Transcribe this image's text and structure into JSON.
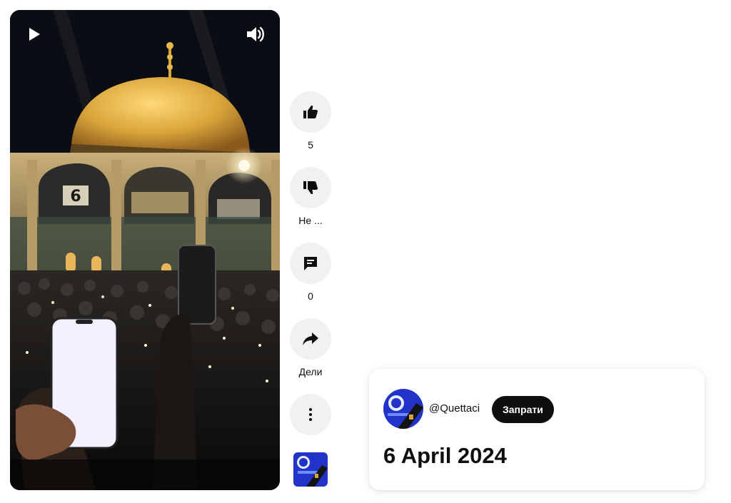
{
  "player": {
    "play_icon": "play-icon",
    "volume_icon": "volume-icon",
    "scene_gate_number": "6"
  },
  "actions": {
    "like": {
      "icon": "thumbs-up-icon",
      "label": "5"
    },
    "dislike": {
      "icon": "thumbs-down-icon",
      "label": "Не ..."
    },
    "comments": {
      "icon": "comment-icon",
      "label": "0"
    },
    "share": {
      "icon": "share-arrow-icon",
      "label": "Дели"
    },
    "more": {
      "icon": "more-vertical-icon"
    }
  },
  "card": {
    "channel_handle": "@Quettaci",
    "subscribe_label": "Запрати",
    "title": "6 April 2024"
  },
  "colors": {
    "button_bg": "#f1f1f1",
    "text": "#0f0f0f",
    "subscribe_bg": "#0f0f0f",
    "dome_gold": "#d9a53a",
    "night_sky": "#0b0d14",
    "channel_blue": "#2233c8"
  }
}
